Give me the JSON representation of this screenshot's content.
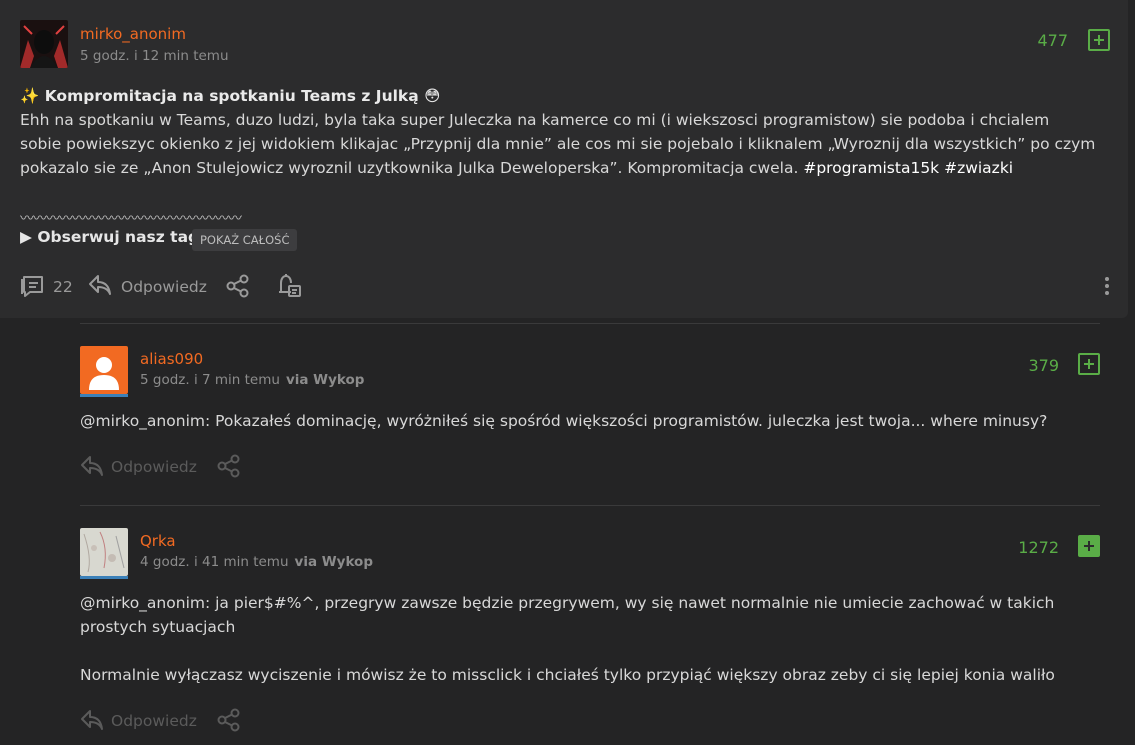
{
  "post": {
    "author": "mirko_anonim",
    "time": "5 godz. i 12 min temu",
    "score": "477",
    "title": "✨ Kompromitacja na spotkaniu Teams z Julką 😳",
    "body_lines": [
      "Ehh na spotkaniu w Teams, duzo ludzi, byla taka super Juleczka na kamerce co mi (i wiekszosci programistow) sie podoba i chcialem",
      "sobie powiekszyc okienko z jej widokiem klikajac „Przypnij dla mnie” ale cos mi sie pojebalo i kliknalem „Wyroznij dla wszystkich” po czym",
      "pokazalo sie ze „Anon Stulejowicz wyroznil uzytkownika Julka Deweloperska”. Kompromitacja cwela."
    ],
    "tags": "#programista15k #zwiazki",
    "wavy": "〰〰〰〰〰〰〰〰〰〰〰〰〰〰〰〰〰",
    "observe": "▶ Obserwuj nasz tag",
    "show_all": "POKAŻ CAŁOŚĆ",
    "comments_count": "22",
    "reply_label": "Odpowiedz"
  },
  "comments": [
    {
      "author": "alias090",
      "time": "5 godz. i 7 min temu",
      "via": "via Wykop",
      "score": "379",
      "text_lines": [
        "@mirko_anonim: Pokazałeś dominację, wyróżniłeś się spośród większości programistów. juleczka jest twoja... where minusy?"
      ],
      "reply_label": "Odpowiedz"
    },
    {
      "author": "Qrka",
      "time": "4 godz. i 41 min temu",
      "via": "via Wykop",
      "score": "1272",
      "text_lines": [
        "@mirko_anonim: ja pier$#%^, przegryw zawsze będzie przegrywem, wy się nawet normalnie nie umiecie zachować w takich",
        "prostych sytuacjach",
        "",
        "Normalnie wyłączasz wyciszenie i mówisz że to missclick i chciałeś tylko przypiąć większy obraz zeby ci się lepiej konia waliło"
      ],
      "reply_label": "Odpowiedz"
    }
  ],
  "colors": {
    "username": "#f26a22",
    "plus": "#5aad47",
    "background": "#242425",
    "post_background": "#2c2c2d"
  }
}
